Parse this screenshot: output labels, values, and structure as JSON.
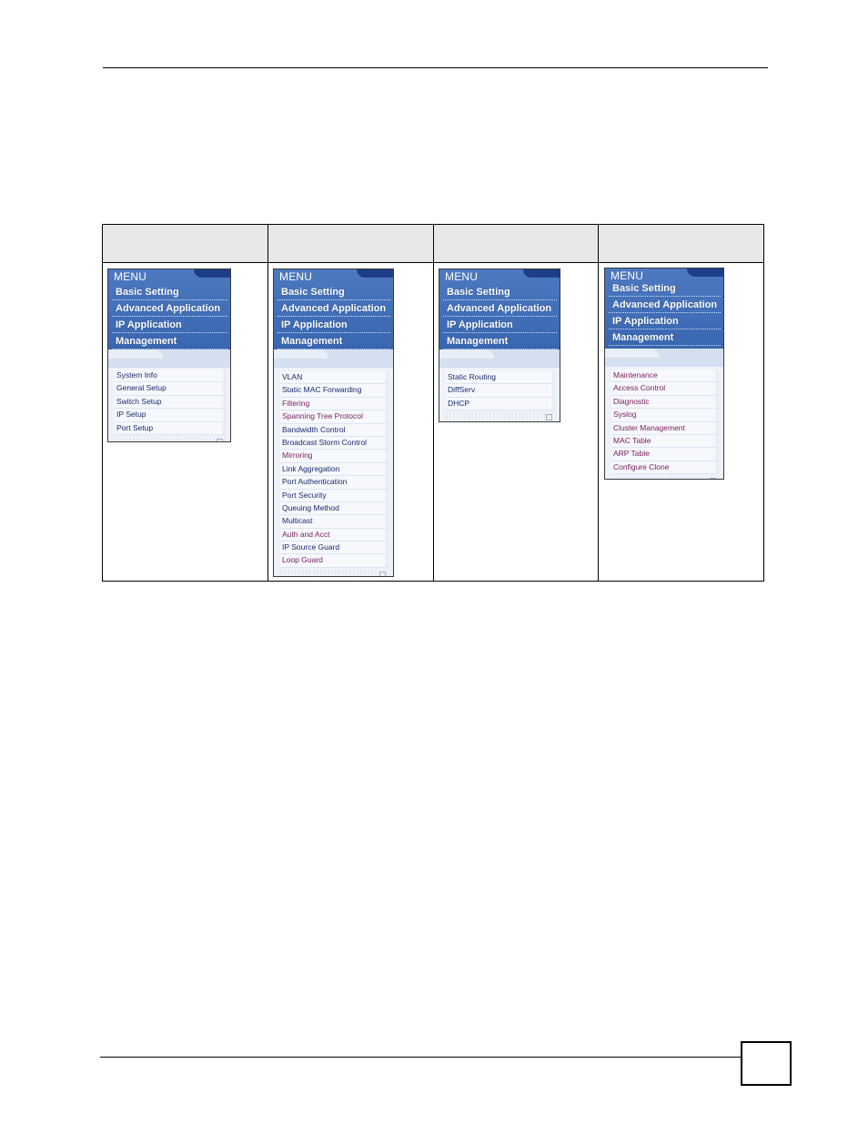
{
  "page": {
    "page_number": ""
  },
  "table": {
    "headers": [
      "",
      "",
      "",
      ""
    ],
    "menus": [
      {
        "title": "MENU",
        "main_items": [
          "Basic Setting",
          "Advanced Application",
          "IP Application",
          "Management"
        ],
        "sub_items": [
          "System Info",
          "General Setup",
          "Switch Setup",
          "IP Setup",
          "Port Setup"
        ]
      },
      {
        "title": "MENU",
        "main_items": [
          "Basic Setting",
          "Advanced Application",
          "IP Application",
          "Management"
        ],
        "sub_items": [
          "VLAN",
          "Static MAC Forwarding",
          "Filtering",
          "Spanning Tree Protocol",
          "Bandwidth Control",
          "Broadcast Storm Control",
          "Mirroring",
          "Link Aggregation",
          "Port Authentication",
          "Port Security",
          "Queuing Method",
          "Multicast",
          "Auth and Acct",
          "IP Source Guard",
          "Loop Guard"
        ]
      },
      {
        "title": "MENU",
        "main_items": [
          "Basic Setting",
          "Advanced Application",
          "IP Application",
          "Management"
        ],
        "sub_items": [
          "Static Routing",
          "DiffServ",
          "DHCP"
        ]
      },
      {
        "title": "MENU",
        "main_items": [
          "Basic Setting",
          "Advanced Application",
          "IP Application",
          "Management"
        ],
        "sub_items": [
          "Maintenance",
          "Access Control",
          "Diagnostic",
          "Syslog",
          "Cluster Management",
          "MAC Table",
          "ARP Table",
          "Configure Clone"
        ]
      }
    ]
  },
  "colors": {
    "menu_header": "#3966b0",
    "menu_notch": "#1d3e86",
    "sub_text": "#1b2a6e",
    "sub_text_alt": "#7a1c5c"
  }
}
